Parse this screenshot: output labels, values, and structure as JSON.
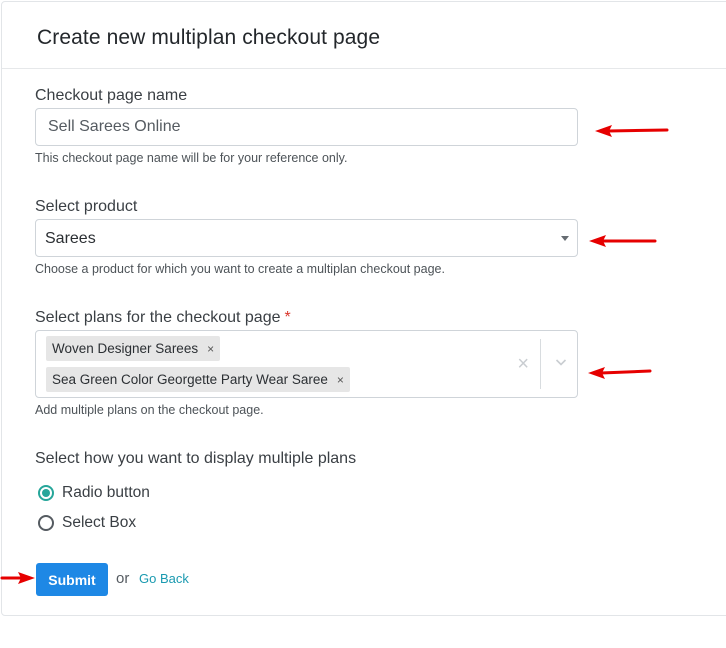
{
  "page": {
    "title": "Create new multiplan checkout page"
  },
  "checkout_name": {
    "label": "Checkout page name",
    "value": "Sell Sarees Online",
    "help": "This checkout page name will be for your reference only."
  },
  "product": {
    "label": "Select product",
    "selected": "Sarees",
    "help": "Choose a product for which you want to create a multiplan checkout page."
  },
  "plans": {
    "label": "Select plans for the checkout page",
    "required_mark": "*",
    "tags": [
      {
        "label": "Woven Designer Sarees",
        "remove": "×"
      },
      {
        "label": "Sea Green Color Georgette Party Wear Saree",
        "remove": "×"
      }
    ],
    "clear": "×",
    "help": "Add multiple plans on the checkout page."
  },
  "display": {
    "label": "Select how you want to display multiple plans",
    "options": [
      {
        "label": "Radio button",
        "checked": true
      },
      {
        "label": "Select Box",
        "checked": false
      }
    ]
  },
  "actions": {
    "submit": "Submit",
    "or": "or",
    "go_back": "Go Back"
  },
  "colors": {
    "accent": "#26a69a",
    "primary_button": "#1e88e5",
    "link": "#1a9ab0",
    "annotation_arrow": "#e60000",
    "required": "#d9352b"
  },
  "icons": {
    "dropdown": "caret-down-icon",
    "multi_dropdown": "chevron-down-icon",
    "annotation": "arrow-left-icon"
  }
}
